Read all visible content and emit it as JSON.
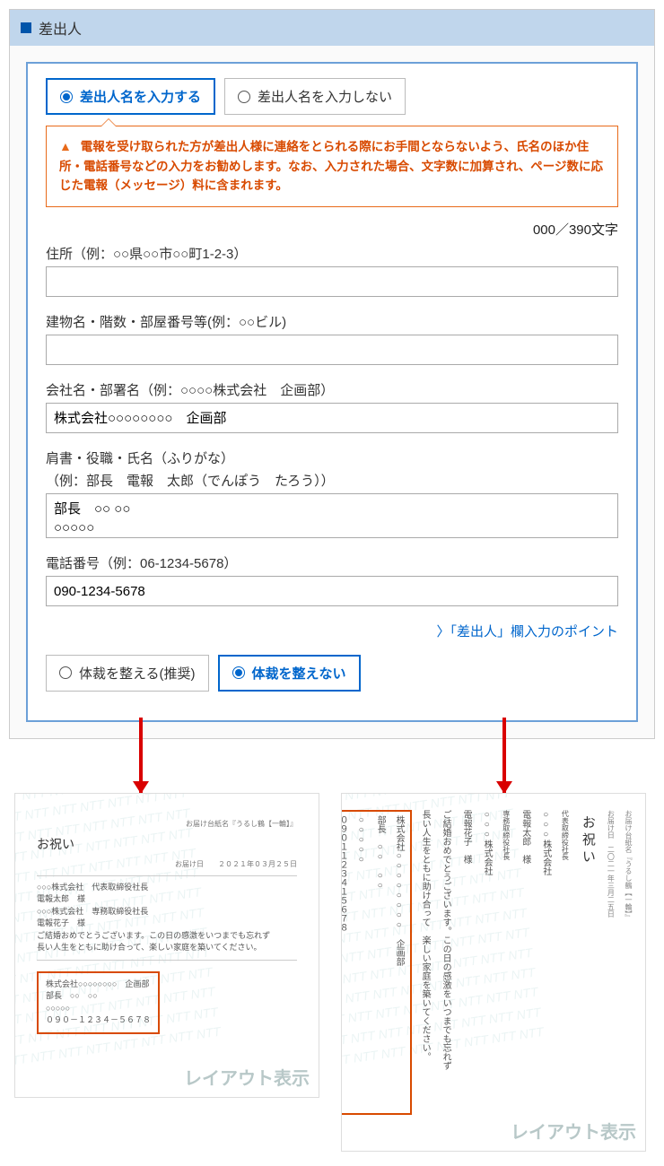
{
  "panel": {
    "title": "差出人"
  },
  "opt_input": {
    "enter": "差出人名を入力する",
    "skip": "差出人名を入力しない"
  },
  "warning": "電報を受け取られた方が差出人様に連絡をとられる際にお手間とならないよう、氏名のほか住所・電話番号などの入力をお勧めします。なお、入力された場合、文字数に加算され、ページ数に応じた電報（メッセージ）料に含まれます。",
  "counter": "000／390文字",
  "fields": {
    "addr": {
      "label": "住所（例：○○県○○市○○町1-2-3）",
      "value": ""
    },
    "bldg": {
      "label": "建物名・階数・部屋番号等(例：○○ビル)",
      "value": ""
    },
    "company": {
      "label": "会社名・部署名（例：○○○○株式会社　企画部）",
      "value": "株式会社○○○○○○○○　企画部"
    },
    "name": {
      "label": "肩書・役職・氏名（ふりがな）",
      "sub": "（例：部長　電報　太郎（でんぽう　たろう））",
      "value": "部長　○○ ○○\n○○○○○"
    },
    "phone": {
      "label": "電話番号（例：06-1234-5678）",
      "value": "090-1234-5678"
    }
  },
  "link": "〉「差出人」欄入力のポイント",
  "format_opt": {
    "tidy": "体裁を整える(推奨)",
    "keep": "体裁を整えない"
  },
  "preview_h": {
    "title": "お祝い",
    "meta1": "お届け台紙名『うるし鶴【一輪】』",
    "meta2": "お届け日　　２０２１年０３月２５日",
    "lines": [
      "○○○株式会社　代表取締役社長",
      "電報太郎　様",
      "○○○株式会社　専務取締役社長",
      "電報花子　様",
      "ご結婚おめでとうございます。この日の感激をいつまでも忘れず",
      "長い人生をともに助け合って、楽しい家庭を築いてください。"
    ],
    "highlight": [
      "株式会社○○○○○○○○　企画部",
      "部長　○○　○○",
      "○○○○○",
      "０９０－１２３４－５６７８"
    ],
    "watermark": "レイアウト表示"
  },
  "preview_v": {
    "title": "お祝い",
    "meta1": "お届け台紙名『うるし鶴【一輪】』",
    "meta2": "お届け日　二〇二一年三月二五日",
    "col_company1": "○○○株式会社",
    "col_role1": "代表取締役社長",
    "col_name1": "電報太郎　様",
    "col_company2": "○○○株式会社",
    "col_role2": "専務取締役社長",
    "col_name2": "電報花子　様",
    "col_msg1": "ご結婚おめでとうございます。この日の感激をいつまでも忘れず",
    "col_msg2": "長い人生をともに助け合って　楽しい家庭を築いてください。",
    "hl_company": "株式会社○○○○○○○○　企画部",
    "hl_role": "部長　○○　○○",
    "hl_furi": "○○○○○",
    "hl_phone": "０９０１１２３４１５６７８",
    "watermark": "レイアウト表示"
  },
  "ntt_bg": "NTT NTT NTT NTT NTT NTT NTT NTT\nNTT NTT NTT NTT NTT NTT NTT NTT\nNTT NTT NTT NTT NTT NTT NTT NTT\nNTT NTT NTT NTT NTT NTT NTT NTT\nNTT NTT NTT NTT NTT NTT NTT NTT\nNTT NTT NTT NTT NTT NTT NTT NTT\nNTT NTT NTT NTT NTT NTT NTT NTT\nNTT NTT NTT NTT NTT NTT NTT NTT\nNTT NTT NTT NTT NTT NTT NTT NTT\nNTT NTT NTT NTT NTT NTT NTT NTT\nNTT NTT NTT NTT NTT NTT NTT NTT\nNTT NTT NTT NTT NTT NTT NTT NTT\nNTT NTT NTT NTT NTT NTT NTT NTT\nNTT NTT NTT NTT NTT NTT NTT NTT"
}
